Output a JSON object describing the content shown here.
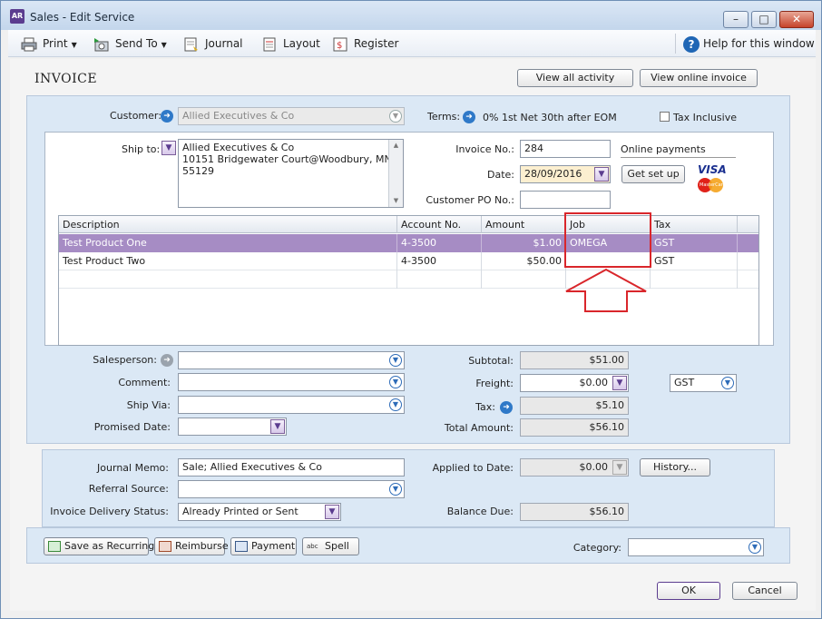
{
  "window": {
    "title": "Sales - Edit Service",
    "app_badge": "AR"
  },
  "toolbar": {
    "print": "Print",
    "send_to": "Send To",
    "journal": "Journal",
    "layout": "Layout",
    "register": "Register",
    "help": "Help for this window"
  },
  "header": {
    "title": "INVOICE",
    "view_all_activity": "View all activity",
    "view_online_invoice": "View online invoice"
  },
  "customer": {
    "label": "Customer:",
    "value": "Allied Executives & Co",
    "terms_label": "Terms:",
    "terms_value": "0% 1st Net 30th after EOM",
    "tax_inclusive_label": "Tax Inclusive"
  },
  "ship_to": {
    "label": "Ship to:",
    "line1": "Allied Executives & Co",
    "line2": "10151 Bridgewater Court@Woodbury, MN",
    "line3": "55129"
  },
  "invoice": {
    "invoice_no_label": "Invoice No.:",
    "invoice_no": "284",
    "date_label": "Date:",
    "date": "28/09/2016",
    "customer_po_label": "Customer PO No.:",
    "customer_po": "",
    "online_payments_label": "Online payments",
    "get_set_up": "Get set up",
    "visa": "VISA",
    "mastercard": "MasterCard"
  },
  "table": {
    "columns": [
      "Description",
      "Account No.",
      "Amount",
      "Job",
      "Tax"
    ],
    "rows": [
      {
        "description": "Test Product One",
        "account": "4-3500",
        "amount": "$1.00",
        "job": "OMEGA",
        "tax": "GST"
      },
      {
        "description": "Test Product Two",
        "account": "4-3500",
        "amount": "$50.00",
        "job": "",
        "tax": "GST"
      }
    ]
  },
  "details": {
    "salesperson_label": "Salesperson:",
    "comment_label": "Comment:",
    "ship_via_label": "Ship Via:",
    "promised_date_label": "Promised Date:"
  },
  "totals": {
    "subtotal_label": "Subtotal:",
    "subtotal": "$51.00",
    "freight_label": "Freight:",
    "freight": "$0.00",
    "freight_tax_code": "GST",
    "tax_label": "Tax:",
    "tax": "$5.10",
    "total_label": "Total Amount:",
    "total": "$56.10"
  },
  "footer": {
    "journal_memo_label": "Journal Memo:",
    "journal_memo": "Sale; Allied Executives & Co",
    "referral_source_label": "Referral Source:",
    "delivery_status_label": "Invoice Delivery Status:",
    "delivery_status": "Already Printed or Sent",
    "applied_to_date_label": "Applied to Date:",
    "applied_to_date": "$0.00",
    "history": "History...",
    "balance_due_label": "Balance Due:",
    "balance_due": "$56.10"
  },
  "actions": {
    "save_recurring": "Save as Recurring",
    "reimburse": "Reimburse",
    "payment": "Payment",
    "spell": "Spell",
    "category_label": "Category:",
    "ok": "OK",
    "cancel": "Cancel"
  },
  "colors": {
    "selected_row": "#a68cc4",
    "annotation_red": "#d9262b",
    "panel_blue": "#dbe8f5"
  }
}
